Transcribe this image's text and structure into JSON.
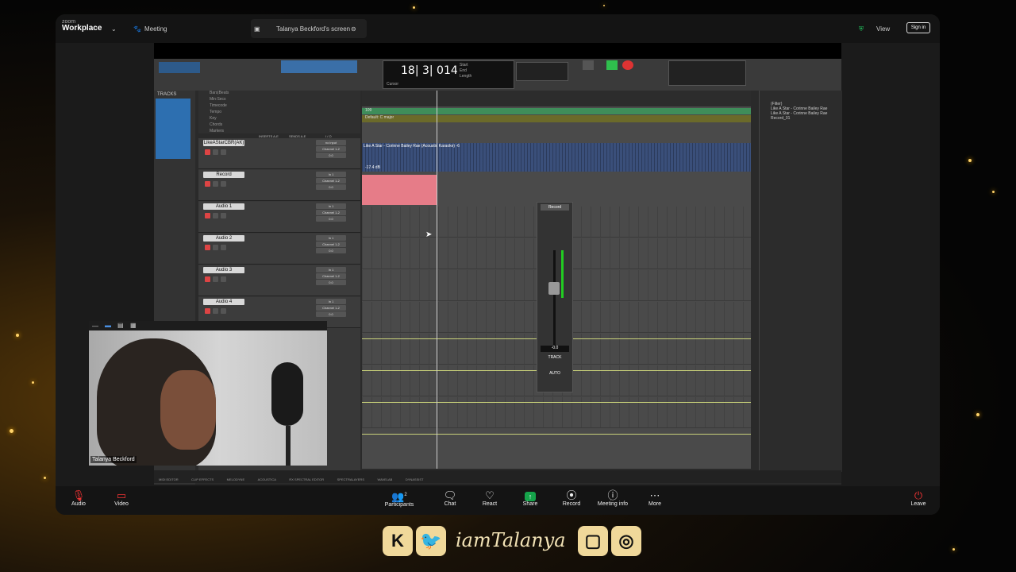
{
  "zoom": {
    "logo_line1": "zoom",
    "logo_line2": "Workplace",
    "meeting_label": "Meeting",
    "share_tab_label": "Talanya Beckford's screen",
    "view_label": "View",
    "signin_label": "Sign in"
  },
  "protools": {
    "counter_main": "18| 3| 014",
    "counter_start": "Start",
    "counter_end": "End",
    "counter_length": "Length",
    "counter_cursor": "Cursor",
    "tracks_header": "TRACKS",
    "rulers": [
      "Bars|Beats",
      "Min:Secs",
      "Timecode",
      "Tempo",
      "Key",
      "Chords",
      "Markers"
    ],
    "column_headers": [
      "INSERTS A-E",
      "SENDS A-E",
      "I / O"
    ],
    "tracks": [
      {
        "name": "LikeAStarCBR(AK)",
        "io_input": "no input",
        "io_output": "Channel 1-2",
        "vol": "0.0"
      },
      {
        "name": "Record",
        "io_input": "In 1",
        "io_output": "Channel 1-2",
        "vol": "0.0"
      },
      {
        "name": "Audio 1",
        "io_input": "In 1",
        "io_output": "Channel 1-2",
        "vol": "0.0"
      },
      {
        "name": "Audio 2",
        "io_input": "In 1",
        "io_output": "Channel 1-2",
        "vol": "0.0"
      },
      {
        "name": "Audio 3",
        "io_input": "In 1",
        "io_output": "Channel 1-2",
        "vol": "0.0"
      },
      {
        "name": "Audio 4",
        "io_input": "In 1",
        "io_output": "Channel 1-2",
        "vol": "0.0"
      }
    ],
    "tempo_marker": "109",
    "key_marker": "Default: C major",
    "clip_name": "Like A Star - Corinne Bailey Rae (Acoustic Karaoke) -6",
    "clip_gain": "-17.4 dB",
    "fader_track": "Record",
    "fader_value": "-0.0",
    "fader_track_label": "TRACK",
    "fader_auto_label": "AUTO",
    "clips_filter": "(Filter)",
    "clips": [
      "Like A Star - Corinne Bailey Rae",
      "Like A Star - Corinne Bailey Rae",
      "Record_01"
    ],
    "bottom_tabs": [
      "MIDI EDITOR",
      "CLIP EFFECTS",
      "MELODYNE",
      "ACOUSTICA",
      "RX SPECTRAL EDITOR",
      "SPECTRALAYERS",
      "WAVELAB",
      "DYNASSIST"
    ]
  },
  "webcam": {
    "name": "Talanya Beckford"
  },
  "zoom_bottom": {
    "audio": "Audio",
    "video": "Video",
    "participants": "Participants",
    "participants_count": "2",
    "chat": "Chat",
    "react": "React",
    "share": "Share",
    "record": "Record",
    "meeting_info": "Meeting info",
    "more": "More",
    "leave": "Leave"
  },
  "footer": {
    "handle": "iamTalanya",
    "icons": [
      "kick-icon",
      "twitter-icon",
      "twitch-icon",
      "instagram-icon"
    ]
  }
}
